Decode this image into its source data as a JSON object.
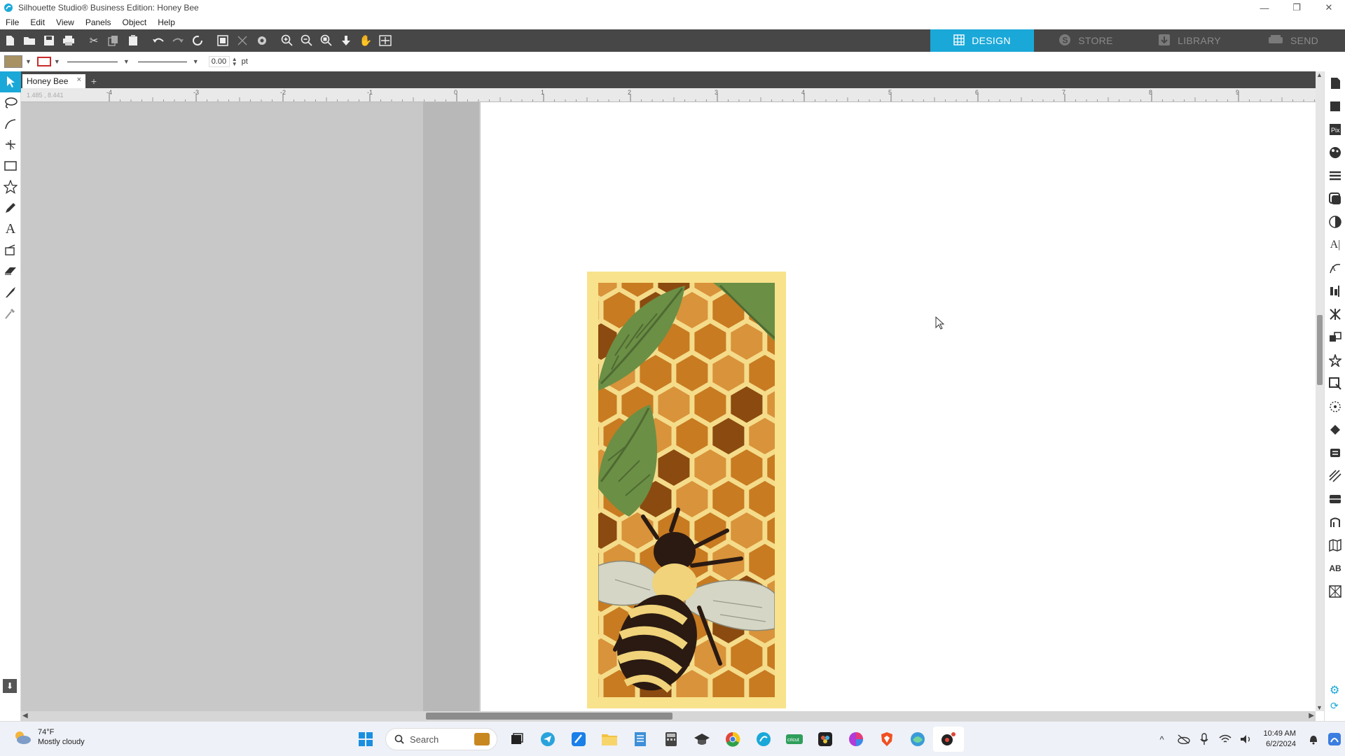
{
  "window": {
    "title": "Silhouette Studio® Business Edition: Honey Bee",
    "controls": [
      "—",
      "❐",
      "✕"
    ]
  },
  "menu": [
    "File",
    "Edit",
    "View",
    "Panels",
    "Object",
    "Help"
  ],
  "toolbar": {
    "buttons": [
      "new-file",
      "open",
      "save",
      "print",
      "cut",
      "copy",
      "paste",
      "undo",
      "redo",
      "rotate",
      "group",
      "ungroup",
      "compound",
      "zoom-in",
      "zoom-out",
      "zoom-fit",
      "move-down",
      "pan",
      "fit-page"
    ]
  },
  "nav_tabs": [
    {
      "label": "DESIGN",
      "active": true
    },
    {
      "label": "STORE",
      "active": false
    },
    {
      "label": "LIBRARY",
      "active": false
    },
    {
      "label": "SEND",
      "active": false
    }
  ],
  "line_settings": {
    "fill_color": "#a89264",
    "line_color": "#c92b2b",
    "line_width_value": "0.00",
    "line_width_unit": "pt"
  },
  "doc_tab": {
    "name": "Honey Bee",
    "close": "×",
    "add": "+"
  },
  "ruler": {
    "coordinate_readout": "1.485 , 8.441",
    "ticks": [
      "-4",
      "-3",
      "-2",
      "-1",
      "0",
      "1",
      "2",
      "3",
      "4",
      "5",
      "6",
      "7",
      "8",
      "9"
    ]
  },
  "artwork": {
    "name": "Honey Bee",
    "colors": {
      "border": "#f8e28b",
      "honey": "#c87b21",
      "honey_light": "#d9933a",
      "honey_dark": "#8b4a0f",
      "comb": "#f4dc8b",
      "leaf": "#6b8f45",
      "leaf_dark": "#4e6a32",
      "bee_body": "#2a1a12",
      "bee_stripe": "#f0d37a",
      "wing": "#d6d6c6"
    }
  },
  "left_tools": [
    "select-tool",
    "lasso-tool",
    "curve-tool",
    "point-edit-tool",
    "rectangle-tool",
    "star-tool",
    "pen-tool",
    "text-tool",
    "fill-tool",
    "eraser-tool",
    "knife-tool",
    "eyedropper-tool"
  ],
  "right_panels": [
    "page-setup",
    "shapes",
    "image-trace",
    "fill-panel",
    "line-style",
    "shadow",
    "transparency",
    "text-style",
    "text-to-path",
    "align",
    "transform",
    "replicate",
    "modify",
    "offset",
    "trace",
    "nesting",
    "weld",
    "layers",
    "scale",
    "sketch",
    "emboss",
    "library",
    "pix-scan"
  ],
  "taskbar": {
    "weather_temp": "74°F",
    "weather_desc": "Mostly cloudy",
    "search_label": "Search",
    "time": "10:49 AM",
    "date": "6/2/2024"
  }
}
